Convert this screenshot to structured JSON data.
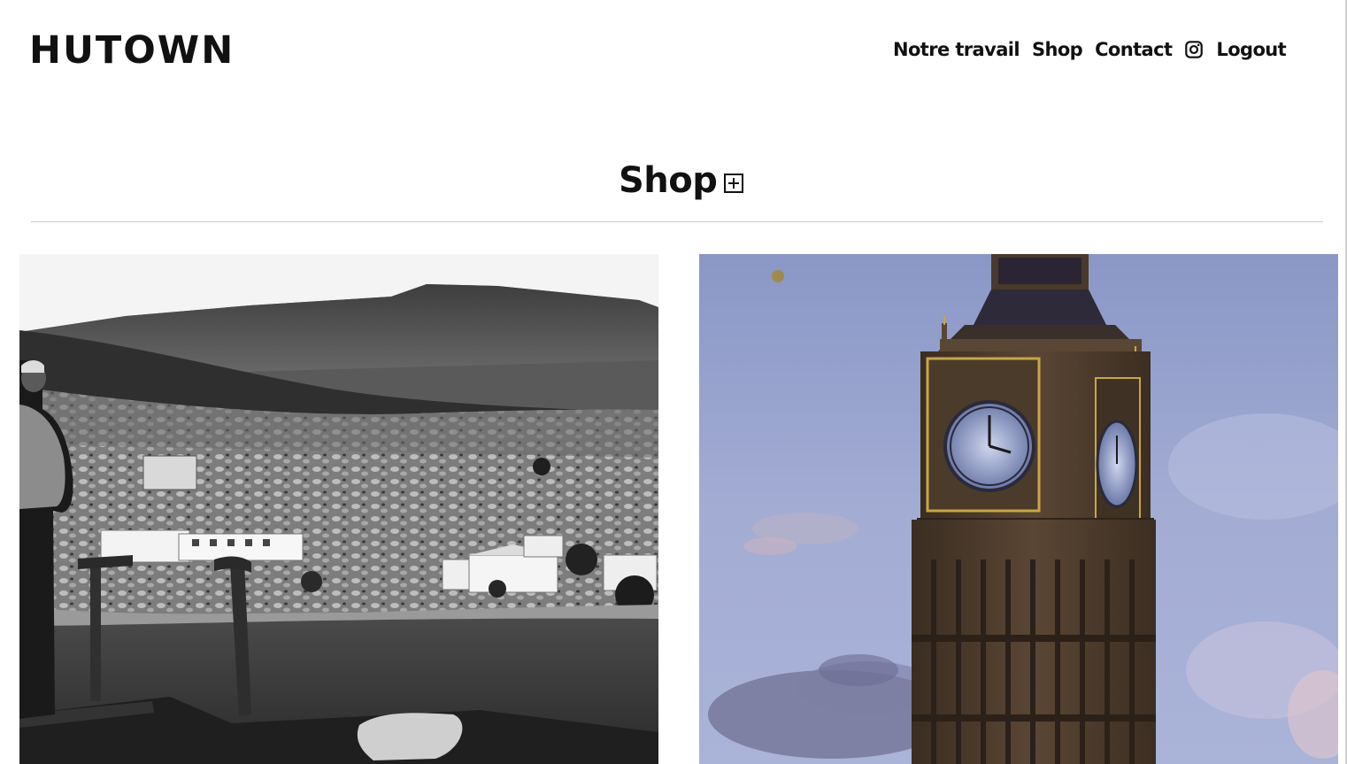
{
  "header": {
    "logo": "HUTOWN",
    "nav": {
      "items": [
        "Notre travail",
        "Shop",
        "Contact"
      ],
      "instagram_icon": "instagram-icon",
      "logout": "Logout"
    }
  },
  "main": {
    "title": "Shop",
    "add_icon": "plus-square-icon"
  },
  "gallery": {
    "items": [
      {
        "name": "coastal-village-photo",
        "style": "black-and-white"
      },
      {
        "name": "big-ben-photo",
        "style": "color"
      }
    ]
  },
  "colors": {
    "text": "#111111",
    "background": "#ffffff",
    "divider": "#cccccc",
    "sky": "#9aa3c8",
    "tower": "#4a3a2b",
    "clock_gold": "#c9a646"
  }
}
